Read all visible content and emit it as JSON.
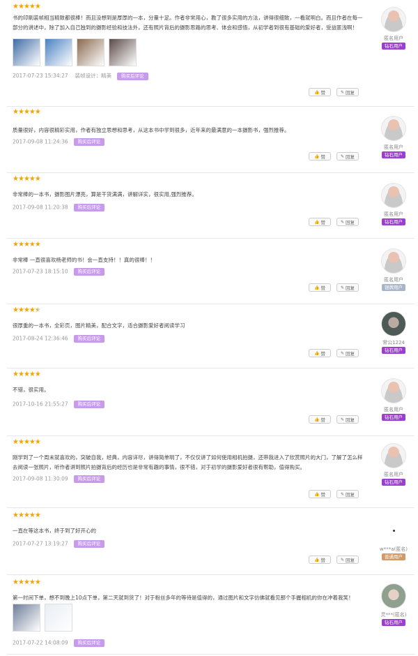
{
  "colors": {
    "star": "#f5a300",
    "badge": "#c79be9",
    "diamond": "#9b3fd1",
    "normal": "#d19a66",
    "silver": "#a8b4c8"
  },
  "vote_labels": {
    "like": "赞",
    "reply": "回复"
  },
  "purchase_badge": "购买后评论",
  "reviews": [
    {
      "rating": 5,
      "text": "书的印刷装帧相当精致都很棒！而且没想到是厚厚的一本，分量十足。作者非常用心，教了很多实用的方法，讲得很细致，一看就明白。而且作者在每一部分的讲述中，除了加入自己独到的摄影经验和技法外，还有照片背后的摄影思路的思考、体会和感悟，从初学者到很有基础的爱好者，受益匪浅啊！",
      "date": "2017-07-23 15:34:27",
      "extra": "装帧设计：精美",
      "user": "匿名用户",
      "level": "钻石用户",
      "level_color": "#9b3fd1",
      "avatar": "default",
      "thumbs": [
        "#3f6da6",
        "#4a82c2",
        "#8b6a4f",
        "#5b4a48"
      ]
    },
    {
      "rating": 5,
      "text": "质量很好，内容很精彩实用，作者有独立思想和思考，从这本书中学到很多，近年来的最满意的一本摄影书，强烈推荐。",
      "date": "2017-09-08 11:24:36",
      "user": "匿名用户",
      "level": "钻石用户",
      "level_color": "#9b3fd1",
      "avatar": "default"
    },
    {
      "rating": 5,
      "text": "非常棒的一本书，摄影图片漂亮，算是干货满满，讲解详实，很实用,强烈推荐。",
      "date": "2017-09-08 11:20:38",
      "user": "匿名用户",
      "level": "钻石用户",
      "level_color": "#9b3fd1",
      "avatar": "default"
    },
    {
      "rating": 5,
      "text": "非常棒 一直很喜欢杨老师的书！会一直支持！！真的很棒！！",
      "date": "2017-07-23 18:15:10",
      "user": "匿名用户",
      "level": "银牌用户",
      "level_color": "#a8b4c8",
      "avatar": "default"
    },
    {
      "rating": 4.5,
      "text": "很厚重的一本书，全彩页，图片精美，配合文字，适合摄影爱好者阅读学习",
      "date": "2017-08-24 12:36:46",
      "user": "常公1224",
      "level": "钻石用户",
      "level_color": "#9b3fd1",
      "avatar": "photo"
    },
    {
      "rating": 5,
      "text": "不错，很实用。",
      "date": "2017-10-16 21:55:27",
      "user": "匿名用户",
      "level": "钻石用户",
      "level_color": "#9b3fd1",
      "avatar": "default"
    },
    {
      "rating": 5,
      "text": "刚学到了一个周末就喜欢的，突破自我，经典，内容详尽，讲得简单明了，不仅仅讲了如何使用相机拍摄，还带我进入了欣赏照片的大门，了解了怎么样去阅读一张照片，听作者讲到照片拍摄背后的经历也是非常有趣的事情，很不错，对于初学的摄影爱好者很有帮助，值得购买。",
      "date": "2017-09-08 11:30:09",
      "user": "匿名用户",
      "level": "钻石用户",
      "level_color": "#9b3fd1",
      "avatar": "default"
    },
    {
      "rating": 5,
      "text": "一直在等这本书，终于到了好开心的",
      "date": "2017-07-27 13:19:27",
      "user": "w***a(匿名)",
      "level": "普通用户",
      "level_color": "#d19a66",
      "avatar": "dot"
    },
    {
      "rating": 5,
      "text": "第一时间下单，想不到晚上10点下单，第二天就到货了！对于粉丝多年的等待是值得的，通过图片和文字仿佛就看见那个手握相机的你在冲着我笑！",
      "date": "2017-07-22 14:08:09",
      "user": "灵***(匿名)",
      "level": "钻石用户",
      "level_color": "#9b3fd1",
      "avatar": "photo2",
      "thumbs": [
        "#6f7f9a",
        "#e9eef3"
      ]
    }
  ]
}
